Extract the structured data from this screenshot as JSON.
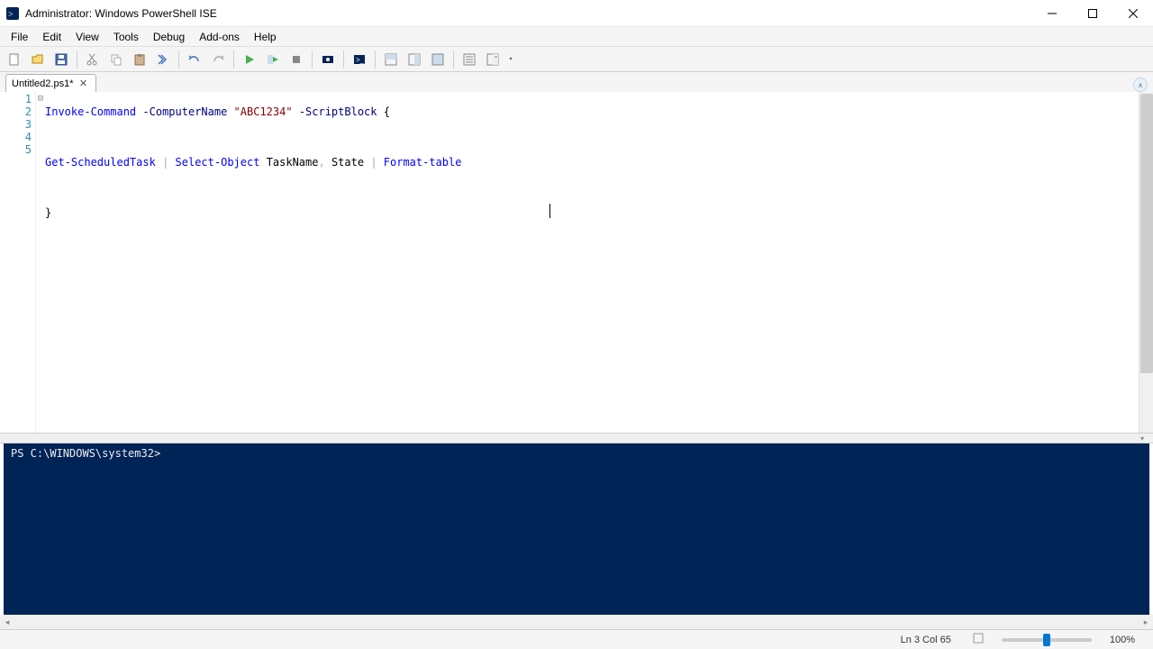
{
  "window": {
    "title": "Administrator: Windows PowerShell ISE"
  },
  "menu": {
    "file": "File",
    "edit": "Edit",
    "view": "View",
    "tools": "Tools",
    "debug": "Debug",
    "addons": "Add-ons",
    "help": "Help"
  },
  "tabs": {
    "active": "Untitled2.ps1*"
  },
  "code": {
    "line1": {
      "cmd": "Invoke-Command",
      "param1": "-ComputerName",
      "str": "\"ABC1234\"",
      "param2": "-ScriptBlock",
      "brace": "{"
    },
    "line3": {
      "cmd1": "Get-ScheduledTask",
      "pipe1": "|",
      "cmd2": "Select-Object",
      "mem1": "TaskName",
      "comma": ",",
      "mem2": "State",
      "pipe2": "|",
      "cmd3": "Format-table"
    },
    "line5": {
      "brace": "}"
    },
    "gutter": {
      "l1": "1",
      "l2": "2",
      "l3": "3",
      "l4": "4",
      "l5": "5"
    },
    "fold": "⊟"
  },
  "console": {
    "prompt": "PS C:\\WINDOWS\\system32>"
  },
  "status": {
    "pos": "Ln 3   Col 65",
    "zoom": "100%"
  }
}
